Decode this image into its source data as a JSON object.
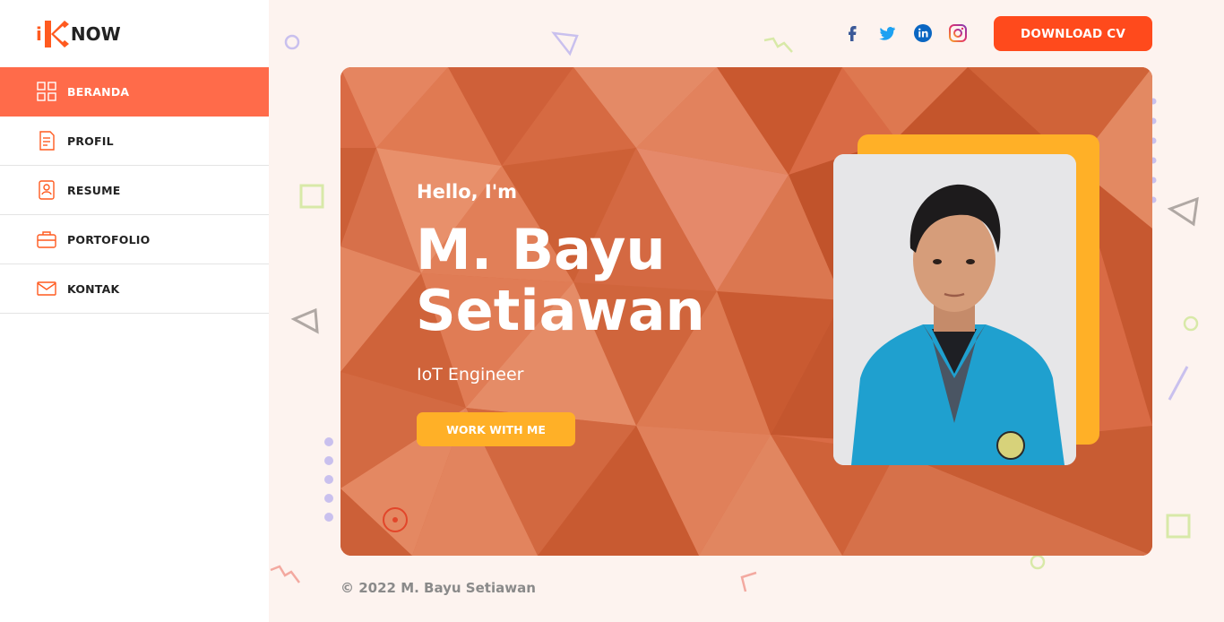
{
  "brand": {
    "logo_text": "NOW",
    "logo_prefix": "i"
  },
  "sidebar": {
    "items": [
      {
        "label": "BERANDA",
        "icon": "dashboard-icon",
        "active": true
      },
      {
        "label": "PROFIL",
        "icon": "document-icon",
        "active": false
      },
      {
        "label": "RESUME",
        "icon": "contact-card-icon",
        "active": false
      },
      {
        "label": "PORTOFOLIO",
        "icon": "briefcase-icon",
        "active": false
      },
      {
        "label": "KONTAK",
        "icon": "mail-icon",
        "active": false
      }
    ]
  },
  "header": {
    "social": [
      {
        "name": "facebook-icon",
        "color": "#3b5998"
      },
      {
        "name": "twitter-icon",
        "color": "#1da1f2"
      },
      {
        "name": "linkedin-icon",
        "color": "#0a66c2"
      },
      {
        "name": "instagram-icon",
        "color": "#e1306c"
      }
    ],
    "download_label": "DOWNLOAD CV"
  },
  "hero": {
    "greeting": "Hello, I'm",
    "name_line1": "M. Bayu",
    "name_line2": "Setiawan",
    "role": "IoT Engineer",
    "cta_label": "WORK WITH ME"
  },
  "footer": {
    "copyright": "© 2022 M. Bayu Setiawan"
  },
  "colors": {
    "accent": "#ff4a1c",
    "accent_soft": "#ff6b4a",
    "yellow": "#ffb027",
    "hero": "#d96b45"
  }
}
